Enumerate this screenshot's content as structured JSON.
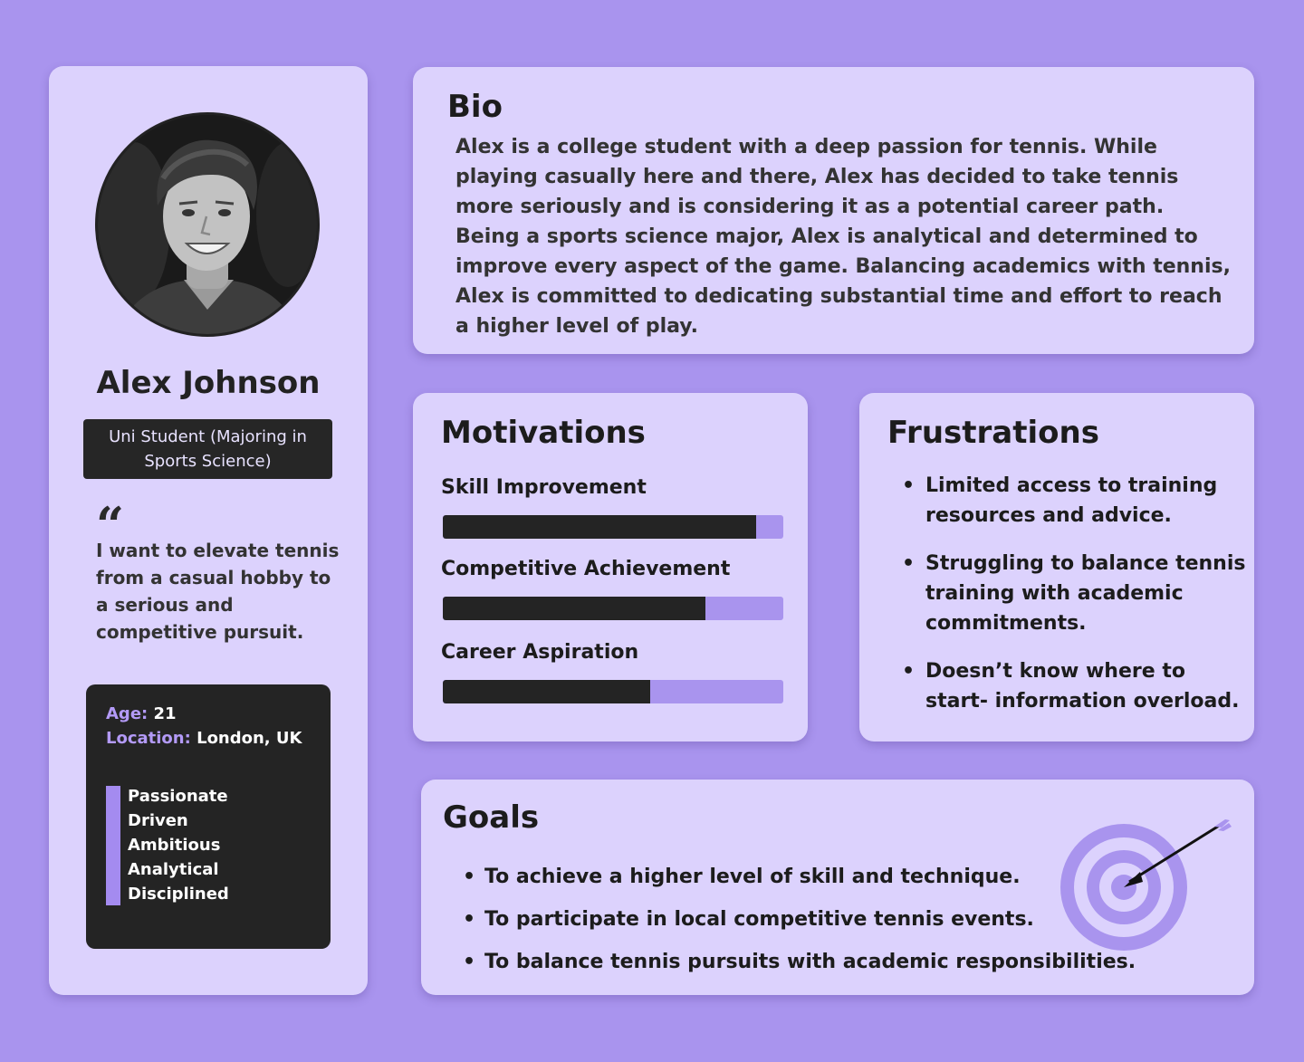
{
  "profile": {
    "name": "Alex Johnson",
    "role": "Uni Student (Majoring in Sports Science)",
    "quote_mark": "“",
    "quote": "I want to elevate tennis from a casual hobby to a serious and competitive pursuit.",
    "age_label": "Age:",
    "age": "21",
    "location_label": "Location:",
    "location": "London, UK",
    "traits": [
      "Passionate",
      "Driven",
      "Ambitious",
      "Analytical",
      "Disciplined"
    ]
  },
  "bio": {
    "title": "Bio",
    "text": "Alex is a college student with a deep passion for tennis. While playing casually here and there, Alex has decided to take tennis more seriously and is considering it as a potential career path. Being a sports science major, Alex is analytical and determined to improve every aspect of the game. Balancing academics with tennis, Alex is committed to dedicating substantial time and effort to reach a higher level of play."
  },
  "motivations": {
    "title": "Motivations",
    "items": [
      {
        "label": "Skill Improvement",
        "level": 0.92
      },
      {
        "label": "Competitive Achievement",
        "level": 0.77
      },
      {
        "label": "Career Aspiration",
        "level": 0.61
      }
    ]
  },
  "frustrations": {
    "title": "Frustrations",
    "items": [
      "Limited access to training resources and advice.",
      "Struggling to balance tennis training with academic commitments.",
      "Doesn’t know where to start- information overload."
    ]
  },
  "goals": {
    "title": "Goals",
    "items": [
      "To achieve a higher level of skill and technique.",
      "To participate in local competitive tennis events.",
      "To balance tennis pursuits with academic responsibilities."
    ]
  },
  "icons": {
    "avatar": "person-photo",
    "quote": "quote-icon",
    "goals": "target-arrow-icon"
  },
  "colors": {
    "background": "#a994ee",
    "card": "#dcd2fd",
    "dark": "#242424",
    "accent": "#a48bf0"
  }
}
